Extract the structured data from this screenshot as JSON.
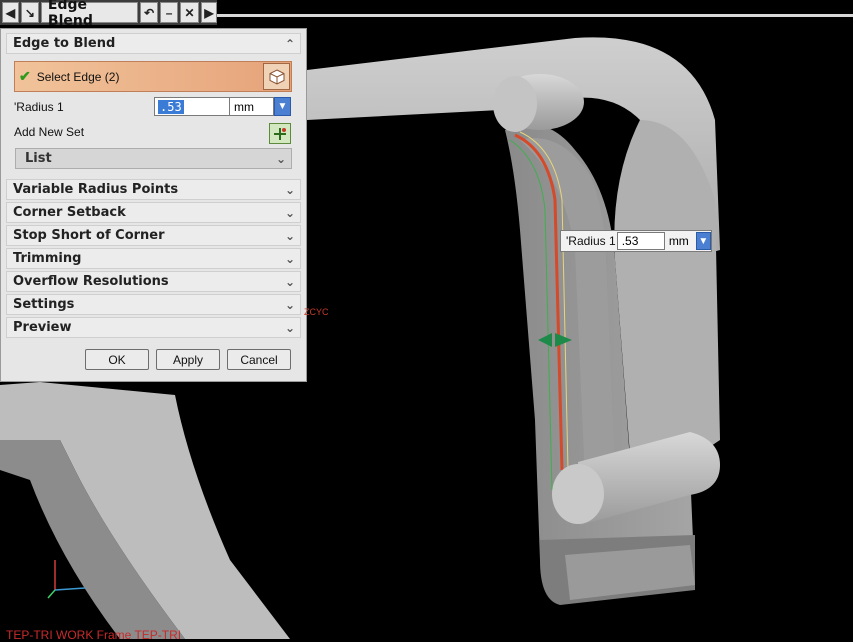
{
  "titlebar": {
    "title": "Edge Blend",
    "back_icon": "chevron-left-icon",
    "select_icon": "cursor-arrow-icon",
    "reset_icon": "undo-icon",
    "minimize_icon": "minus-icon",
    "close_icon": "close-icon",
    "forward_icon": "chevron-right-icon"
  },
  "edge_to_blend": {
    "header": "Edge to Blend",
    "select_edge_label": "Select Edge (2)",
    "radius_label": "'Radius 1",
    "radius_value": ".53",
    "radius_unit": "mm",
    "add_new_set_label": "Add New Set",
    "list_label": "List"
  },
  "groups": [
    "Variable Radius Points",
    "Corner Setback",
    "Stop Short of Corner",
    "Trimming",
    "Overflow Resolutions",
    "Settings",
    "Preview"
  ],
  "buttons": {
    "ok": "OK",
    "apply": "Apply",
    "cancel": "Cancel"
  },
  "viewport": {
    "radius_label": "'Radius 1",
    "radius_value": ".53",
    "radius_unit": "mm",
    "axis_label": "ZCYC",
    "bottom_text": "TEP-TRI WORK Frame TEP-TRI",
    "model_color": "#a9a9a9",
    "edge_highlight_color": "#d44a2a"
  }
}
